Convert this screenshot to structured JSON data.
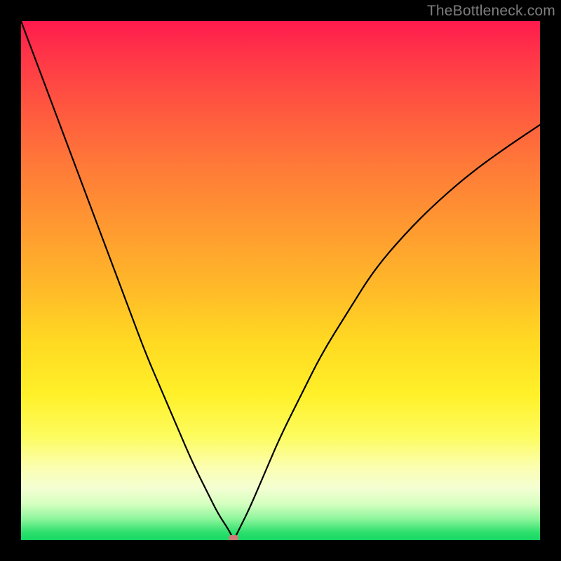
{
  "watermark": {
    "text": "TheBottleneck.com"
  },
  "colors": {
    "frame": "#000000",
    "curve": "#000000",
    "marker": "#cf7a79",
    "gradient_top": "#ff1a4d",
    "gradient_bottom": "#17d765"
  },
  "chart_data": {
    "type": "line",
    "title": "",
    "xlabel": "",
    "ylabel": "",
    "xlim": [
      0,
      100
    ],
    "ylim": [
      0,
      100
    ],
    "grid": false,
    "legend": false,
    "annotations": [
      {
        "kind": "marker",
        "x": 41,
        "y": 0,
        "color": "#cf7a79"
      }
    ],
    "series": [
      {
        "name": "bottleneck-curve",
        "x": [
          0,
          3,
          6,
          9,
          12,
          15,
          18,
          21,
          24,
          27,
          30,
          33,
          36,
          38,
          40,
          41,
          42,
          44,
          47,
          50,
          54,
          58,
          63,
          68,
          74,
          80,
          87,
          94,
          100
        ],
        "y": [
          100,
          92,
          84,
          76,
          68,
          60,
          52,
          44,
          36,
          29,
          22,
          15,
          9,
          5,
          2,
          0,
          2,
          6,
          13,
          20,
          28,
          36,
          44,
          52,
          59,
          65,
          71,
          76,
          80
        ]
      }
    ],
    "notes": "x and y are in percent of the plot area; y=0 is the bottom edge, y=100 is the top edge. Values estimated from pixel positions."
  }
}
